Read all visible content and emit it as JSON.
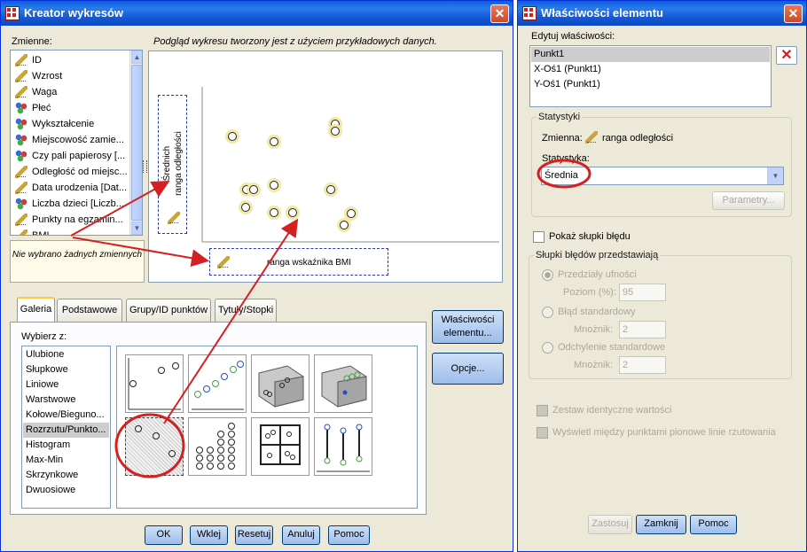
{
  "left_window": {
    "title": "Kreator wykresów",
    "variables_label": "Zmienne:",
    "preview_note": "Podgląd wykresu tworzony jest z użyciem przykładowych danych.",
    "variables": [
      {
        "label": "ID",
        "icon": "scale-ruler-icon"
      },
      {
        "label": "Wzrost",
        "icon": "scale-ruler-icon"
      },
      {
        "label": "Waga",
        "icon": "scale-ruler-icon"
      },
      {
        "label": "Płeć",
        "icon": "nominal-icon"
      },
      {
        "label": "Wykształcenie",
        "icon": "nominal-icon"
      },
      {
        "label": "Miejscowość zamie...",
        "icon": "nominal-icon"
      },
      {
        "label": "Czy pali papierosy [...",
        "icon": "nominal-icon"
      },
      {
        "label": "Odległość od miejsc...",
        "icon": "scale-ruler-icon"
      },
      {
        "label": "Data urodzenia [Dat...",
        "icon": "date-ruler-icon"
      },
      {
        "label": "Liczba dzieci [Liczb...",
        "icon": "nominal-icon"
      },
      {
        "label": "Punkty na egzamin...",
        "icon": "scale-ruler-icon"
      },
      {
        "label": "BMI",
        "icon": "scale-ruler-icon"
      }
    ],
    "filter_note": "Nie wybrano żadnych zmiennych",
    "y_axis_label_line1": "Średnich",
    "y_axis_label_line2": "ranga odległości",
    "x_axis_label": "ranga wskaźnika BMI",
    "tabs": [
      "Galeria",
      "Podstawowe",
      "Grupy/ID punktów",
      "Tytuły/Stopki"
    ],
    "choose_from_label": "Wybierz z:",
    "gallery_types": [
      "Ulubione",
      "Słupkowe",
      "Liniowe",
      "Warstwowe",
      "Kołowe/Bieguno...",
      "Rozrzutu/Punkto...",
      "Histogram",
      "Max-Min",
      "Skrzynkowe",
      "Dwuosiowe"
    ],
    "selected_gallery_type": "Rozrzutu/Punkto...",
    "side_buttons": {
      "element_properties": "Właściwości elementu...",
      "options": "Opcje..."
    },
    "bottom_buttons": [
      "OK",
      "Wklej",
      "Resetuj",
      "Anuluj",
      "Pomoc"
    ]
  },
  "right_window": {
    "title": "Właściwości elementu",
    "edit_properties_label": "Edytuj właściwości:",
    "elements": [
      "Punkt1",
      "X-Oś1 (Punkt1)",
      "Y-Oś1 (Punkt1)"
    ],
    "statistics_group": "Statystyki",
    "variable_label": "Zmienna:",
    "variable_value": "ranga odległości",
    "statistic_label": "Statystyka:",
    "statistic_value": "Średnia",
    "parameters_button": "Parametry...",
    "show_error_bars": "Pokaż słupki błędu",
    "error_bars_group": "Słupki błędów przedstawiają",
    "ci_label": "Przedziały ufności",
    "level_label": "Poziom (%):",
    "level_value": "95",
    "se_label": "Błąd standardowy",
    "multiplier_label": "Mnożnik:",
    "se_multiplier": "2",
    "sd_label": "Odchylenie standardowe",
    "sd_multiplier": "2",
    "stack_identical": "Zestaw identyczne wartości",
    "drop_lines": "Wyświetl między punktami pionowe linie rzutowania",
    "bottom_buttons": [
      "Zastosuj",
      "Zamknij",
      "Pomoc"
    ]
  },
  "colors": {
    "titlebar": "#1456d4",
    "highlight": "#d42020",
    "point_fill": "#f3e8a6"
  }
}
